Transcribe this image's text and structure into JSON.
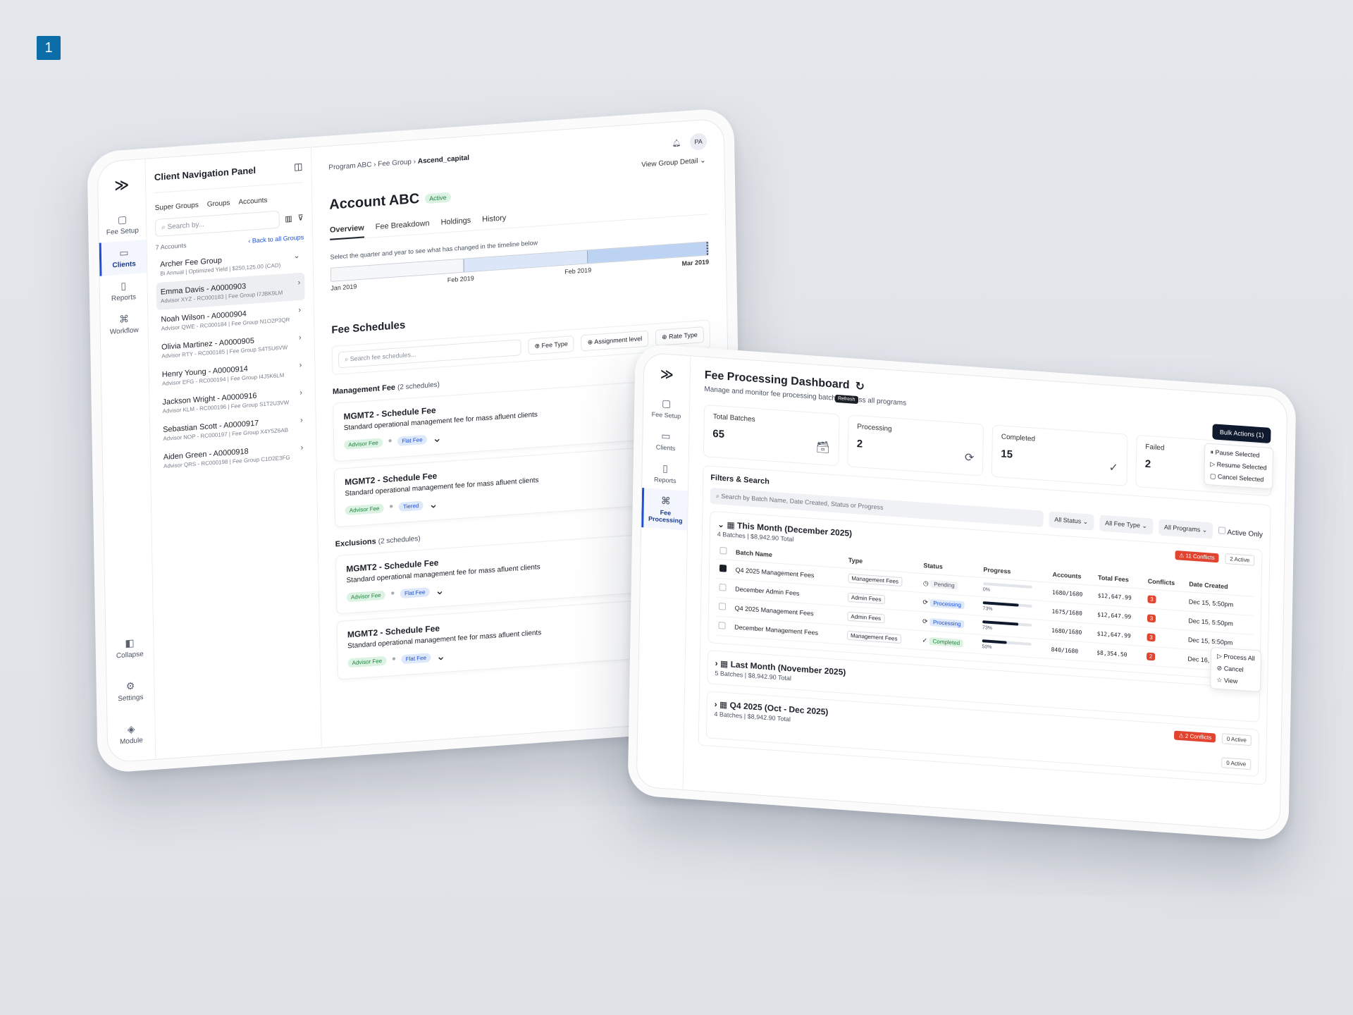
{
  "badge": "1",
  "tablet1": {
    "rail": {
      "items": [
        {
          "label": "Fee Setup",
          "icon": "fee-setup-icon"
        },
        {
          "label": "Clients",
          "icon": "book-icon",
          "active": true
        },
        {
          "label": "Reports",
          "icon": "file-icon"
        },
        {
          "label": "Workflow",
          "icon": "command-icon"
        }
      ],
      "bottom": [
        {
          "label": "Collapse",
          "icon": "collapse-icon"
        },
        {
          "label": "Settings",
          "icon": "gear-icon"
        },
        {
          "label": "Module",
          "icon": "layers-icon"
        }
      ]
    },
    "nav": {
      "title": "Client Navigation Panel",
      "tabs": [
        "Super Groups",
        "Groups",
        "Accounts"
      ],
      "search_placeholder": "Search by...",
      "count": "7 Accounts",
      "back": "Back to all Groups",
      "group": {
        "name": "Archer Fee Group",
        "sub": "Bi Annual | Optimized Yield | $250,125.00 (CAD)"
      },
      "clients": [
        {
          "name": "Emma Davis - A0000903",
          "sub": "Advisor XYZ - RC000183 | Fee Group I7JBK9LM"
        },
        {
          "name": "Noah Wilson - A0000904",
          "sub": "Advisor QWE - RC000184 | Fee Group N1O2P3QR"
        },
        {
          "name": "Olivia Martinez - A0000905",
          "sub": "Advisor RTY - RC000185 | Fee Group S4T5U6VW"
        },
        {
          "name": "Henry Young - A0000914",
          "sub": "Advisor EFG - RC000194 | Fee Group I4J5K6LM"
        },
        {
          "name": "Jackson Wright - A0000916",
          "sub": "Advisor KLM - RC000196 | Fee Group S1T2U3VW"
        },
        {
          "name": "Sebastian Scott - A0000917",
          "sub": "Advisor NOP - RC000197 | Fee Group X4Y5Z6AB"
        },
        {
          "name": "Aiden Green - A0000918",
          "sub": "Advisor QRS - RC000198 | Fee Group C1D2E3FG"
        }
      ]
    },
    "breadcrumb": [
      "Program ABC",
      "Fee Group",
      "Ascend_capital"
    ],
    "user_initials": "PA",
    "view_group": "View Group Detail",
    "account": {
      "title": "Account ABC",
      "status": "Active"
    },
    "tabs": [
      "Overview",
      "Fee Breakdown",
      "Holdings",
      "History"
    ],
    "timeline": {
      "hint": "Select the quarter and year to see what has changed in the timeline below",
      "labels": [
        "Jan 2019",
        "Feb 2019",
        "Feb 2019",
        "Mar 2019"
      ]
    },
    "fee_schedules": {
      "title": "Fee Schedules",
      "search_placeholder": "Search fee schedules...",
      "filters": [
        "Fee Type",
        "Assignment level",
        "Rate Type"
      ],
      "groups": [
        {
          "name": "Management Fee",
          "count": "(2 schedules)",
          "items": [
            {
              "title": "MGMT2 - Schedule Fee",
              "desc": "Standard operational management fee for mass afluent clients",
              "tags": [
                "Advisor Fee",
                "Flat Fee"
              ]
            },
            {
              "title": "MGMT2 - Schedule Fee",
              "desc": "Standard operational management fee for mass afluent clients",
              "tags": [
                "Advisor Fee",
                "Tiered"
              ]
            }
          ]
        },
        {
          "name": "Exclusions",
          "count": "(2 schedules)",
          "items": [
            {
              "title": "MGMT2 - Schedule Fee",
              "desc": "Standard operational management fee for mass afluent clients",
              "tags": [
                "Advisor Fee",
                "Flat Fee"
              ]
            },
            {
              "title": "MGMT2 - Schedule Fee",
              "desc": "Standard operational management fee for mass afluent clients",
              "tags": [
                "Advisor Fee",
                "Flat Fee"
              ]
            }
          ]
        }
      ]
    }
  },
  "tablet2": {
    "rail": [
      {
        "label": "Fee Setup",
        "icon": "fee-setup-icon"
      },
      {
        "label": "Clients",
        "icon": "book-icon"
      },
      {
        "label": "Reports",
        "icon": "file-icon"
      },
      {
        "label": "Fee Processing",
        "icon": "command-icon",
        "active": true
      }
    ],
    "title": "Fee Processing Dashboard",
    "subtitle": "Manage and monitor fee processing batches across all programs",
    "tooltip": "Refresh",
    "bulk": {
      "label": "Bulk Actions (1)",
      "menu": [
        "Pause Selected",
        "Resume Selected",
        "Cancel Selected"
      ]
    },
    "stats": [
      {
        "label": "Total Batches",
        "value": "65",
        "icon": "archive-icon"
      },
      {
        "label": "Processing",
        "value": "2",
        "icon": "refresh-icon"
      },
      {
        "label": "Completed",
        "value": "15",
        "icon": "check-circle-icon"
      },
      {
        "label": "Failed",
        "value": "2",
        "icon": "warning-icon"
      }
    ],
    "filters": {
      "title": "Filters & Search",
      "search_placeholder": "Search by Batch Name, Date Created, Status or Progress",
      "dropdowns": [
        "All Status",
        "All Fee Type",
        "All Programs"
      ],
      "checkbox": "Active Only"
    },
    "groups": [
      {
        "title": "This Month (December 2025)",
        "sub": "4 Batches | $8,942.90 Total",
        "conflicts": "11 Conflicts",
        "active": "2 Active",
        "columns": [
          "Batch Name",
          "Type",
          "Status",
          "Progress",
          "Accounts",
          "Total Fees",
          "Conflicts",
          "Date Created"
        ],
        "rows": [
          {
            "name": "Q4 2025 Management Fees",
            "type": "Management Fees",
            "status": "Pending",
            "progress": 0,
            "progress_label": "0%",
            "accounts": "1680/1680",
            "fees": "$12,647.99",
            "conflicts": "3",
            "date": "Dec 15, 5:50pm",
            "checked": true
          },
          {
            "name": "December Admin Fees",
            "type": "Admin Fees",
            "status": "Processing",
            "progress": 73,
            "progress_label": "73%",
            "accounts": "1675/1680",
            "fees": "$12,647.99",
            "conflicts": "3",
            "date": "Dec 15, 5:50pm",
            "checked": false
          },
          {
            "name": "Q4 2025 Management Fees",
            "type": "Admin Fees",
            "status": "Processing",
            "progress": 73,
            "progress_label": "73%",
            "accounts": "1680/1680",
            "fees": "$12,647.99",
            "conflicts": "3",
            "date": "Dec 15, 5:50pm",
            "checked": false
          },
          {
            "name": "December Management Fees",
            "type": "Management Fees",
            "status": "Completed",
            "progress": 50,
            "progress_label": "50%",
            "accounts": "840/1680",
            "fees": "$8,354.50",
            "conflicts": "2",
            "date": "Dec 16, 10:00am",
            "checked": false
          }
        ]
      },
      {
        "title": "Last Month (November 2025)",
        "sub": "5 Batches | $8,942.90 Total"
      },
      {
        "title": "Q4 2025 (Oct - Dec 2025)",
        "sub": "4 Batches | $8,942.90 Total",
        "conflicts": "2 Conflicts",
        "active": "0 Active"
      }
    ],
    "extra_active": "0 Active",
    "row_menu": [
      "Process All",
      "Cancel",
      "View"
    ]
  }
}
